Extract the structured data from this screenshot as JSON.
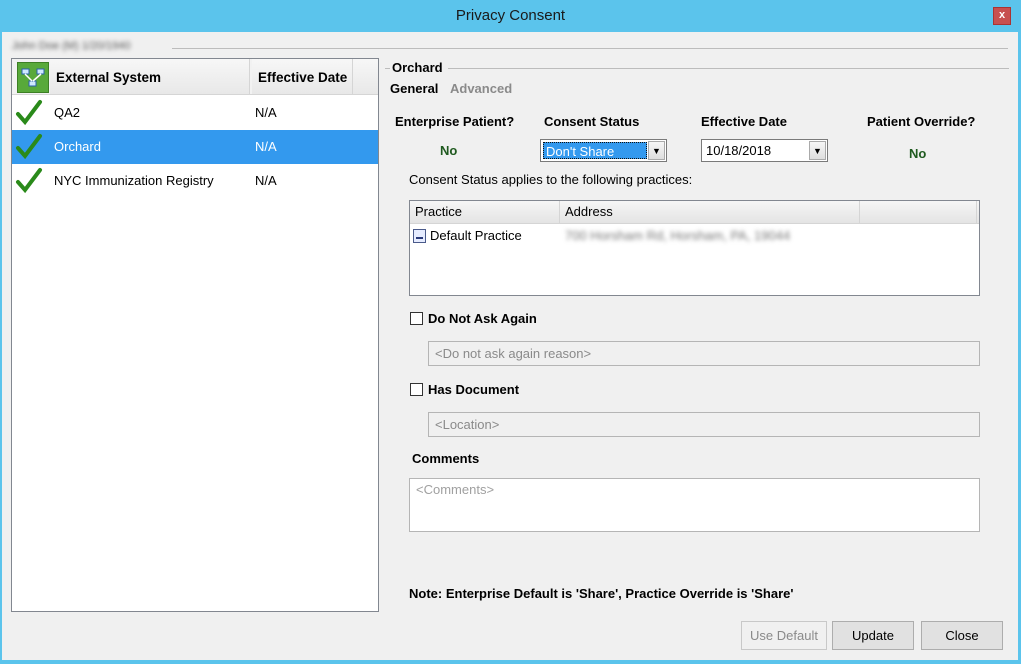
{
  "window": {
    "title": "Privacy Consent",
    "close_label": "x"
  },
  "patient": {
    "header": "John Doe (M) 1/20/1940"
  },
  "systems": {
    "columns": {
      "system": "External System",
      "date": "Effective Date"
    },
    "rows": [
      {
        "name": "QA2",
        "date": "N/A"
      },
      {
        "name": "Orchard",
        "date": "N/A"
      },
      {
        "name": "NYC Immunization Registry",
        "date": "N/A"
      }
    ]
  },
  "detail": {
    "group_title": "Orchard",
    "tabs": {
      "general": "General",
      "advanced": "Advanced"
    },
    "enterprise_patient": {
      "label": "Enterprise Patient?",
      "value": "No"
    },
    "consent_status": {
      "label": "Consent Status",
      "value": "Don't Share"
    },
    "effective_date": {
      "label": "Effective Date",
      "value": "10/18/2018"
    },
    "patient_override": {
      "label": "Patient Override?",
      "value": "No"
    },
    "applies_text": "Consent Status applies to the following practices:",
    "practices": {
      "columns": {
        "practice": "Practice",
        "address": "Address"
      },
      "rows": [
        {
          "practice": "Default Practice",
          "address": "700 Horsham Rd, Horsham, PA, 19044"
        }
      ]
    },
    "do_not_ask": {
      "label": "Do Not Ask Again",
      "placeholder": "<Do not ask again reason>"
    },
    "has_document": {
      "label": "Has Document",
      "placeholder": "<Location>"
    },
    "comments": {
      "label": "Comments",
      "placeholder": "<Comments>"
    },
    "note": "Note: Enterprise Default is 'Share', Practice Override is 'Share'"
  },
  "buttons": {
    "use_default": "Use Default",
    "update": "Update",
    "close": "Close"
  },
  "colors": {
    "title_bar": "#5bc4ec",
    "selection": "#3399ee",
    "check": "#2a8a1a",
    "value_green": "#1f5a1f"
  }
}
